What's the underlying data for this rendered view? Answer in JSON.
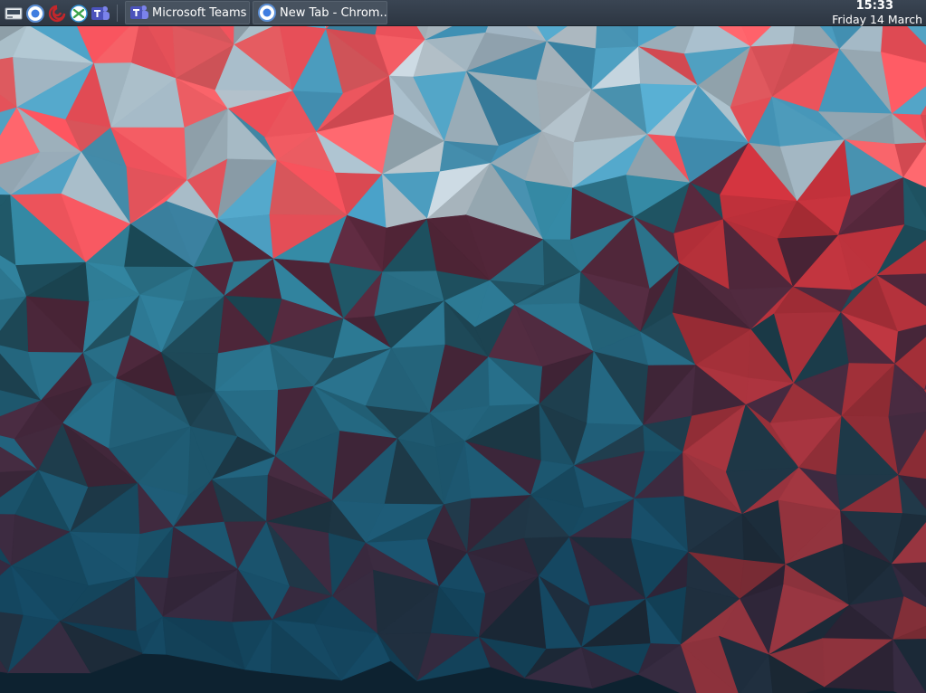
{
  "taskbar": {
    "launchers": [
      {
        "name": "show-desktop-icon"
      },
      {
        "name": "chrome-icon"
      },
      {
        "name": "debian-swirl-icon"
      },
      {
        "name": "remote-desktop-icon"
      },
      {
        "name": "teams-icon"
      }
    ],
    "tasks": [
      {
        "label": "Microsoft Teams",
        "icon": "teams-icon",
        "active": false
      },
      {
        "label": "New Tab - Chrom...",
        "icon": "chrome-icon",
        "active": false
      }
    ],
    "clock": {
      "time": "15:33",
      "date": "Friday 14 March"
    }
  },
  "colors": {
    "taskbar_bg": "#333c48",
    "task_button_bg": "#47525f",
    "wallpaper_red": "#f0505a",
    "wallpaper_blue": "#1f7aa6",
    "wallpaper_dark": "#0e2433",
    "wallpaper_light": "#b8c3cc"
  }
}
